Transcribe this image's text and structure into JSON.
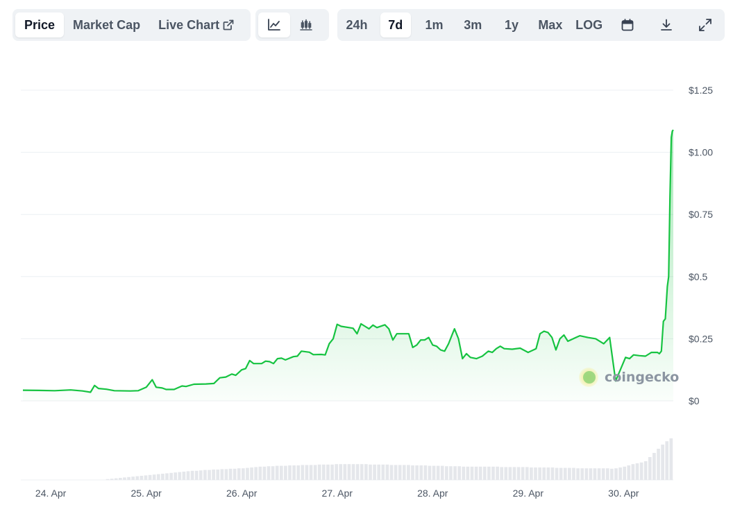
{
  "toolbar": {
    "view_tabs": [
      "Price",
      "Market Cap",
      "Live Chart"
    ],
    "active_view": "Price",
    "chart_type_buttons": [
      "line-chart-icon",
      "candlestick-icon"
    ],
    "active_chart_type": "line-chart-icon",
    "ranges": [
      "24h",
      "7d",
      "1m",
      "3m",
      "1y",
      "Max",
      "LOG"
    ],
    "active_range": "7d",
    "tool_icons": [
      "calendar-icon",
      "download-icon",
      "fullscreen-icon"
    ]
  },
  "watermark": {
    "text": "coingecko"
  },
  "colors": {
    "line": "#16c341",
    "fill": "#16c341",
    "grid": "#eceff3",
    "volume": "#e5e7eb",
    "accent_dot": "#f5e663"
  },
  "chart_data": {
    "type": "line",
    "y_tick_labels": [
      "$0",
      "$0.25",
      "$0.5",
      "$0.75",
      "$1.00",
      "$1.25"
    ],
    "y_ticks": [
      0,
      0.25,
      0.5,
      0.75,
      1.0,
      1.25
    ],
    "ylim": [
      0,
      1.25
    ],
    "x_tick_labels": [
      "24. Apr",
      "25. Apr",
      "26. Apr",
      "27. Apr",
      "28. Apr",
      "29. Apr",
      "30. Apr"
    ],
    "xlim": [
      "2024-04-23T17:00",
      "2024-04-30T12:30"
    ],
    "x_ticks": [
      "2024-04-24T00:00",
      "2024-04-25T00:00",
      "2024-04-26T00:00",
      "2024-04-27T00:00",
      "2024-04-28T00:00",
      "2024-04-29T00:00",
      "2024-04-30T00:00"
    ],
    "grid": true,
    "series": [
      {
        "points": [
          [
            "2024-04-23T17:00",
            0.043
          ],
          [
            "2024-04-23T21:00",
            0.042
          ],
          [
            "2024-04-24T01:00",
            0.041
          ],
          [
            "2024-04-24T05:00",
            0.044
          ],
          [
            "2024-04-24T08:00",
            0.04
          ],
          [
            "2024-04-24T10:00",
            0.035
          ],
          [
            "2024-04-24T11:00",
            0.062
          ],
          [
            "2024-04-24T12:00",
            0.05
          ],
          [
            "2024-04-24T14:00",
            0.047
          ],
          [
            "2024-04-24T16:00",
            0.041
          ],
          [
            "2024-04-24T20:00",
            0.04
          ],
          [
            "2024-04-24T22:00",
            0.041
          ],
          [
            "2024-04-25T00:00",
            0.055
          ],
          [
            "2024-04-25T01:30",
            0.085
          ],
          [
            "2024-04-25T02:30",
            0.055
          ],
          [
            "2024-04-25T04:00",
            0.052
          ],
          [
            "2024-04-25T05:00",
            0.046
          ],
          [
            "2024-04-25T07:00",
            0.046
          ],
          [
            "2024-04-25T09:00",
            0.06
          ],
          [
            "2024-04-25T10:00",
            0.058
          ],
          [
            "2024-04-25T12:00",
            0.067
          ],
          [
            "2024-04-25T15:00",
            0.068
          ],
          [
            "2024-04-25T17:00",
            0.07
          ],
          [
            "2024-04-25T18:30",
            0.093
          ],
          [
            "2024-04-25T20:00",
            0.096
          ],
          [
            "2024-04-25T21:30",
            0.108
          ],
          [
            "2024-04-25T22:30",
            0.103
          ],
          [
            "2024-04-26T00:00",
            0.125
          ],
          [
            "2024-04-26T01:00",
            0.13
          ],
          [
            "2024-04-26T02:00",
            0.162
          ],
          [
            "2024-04-26T03:00",
            0.15
          ],
          [
            "2024-04-26T05:00",
            0.15
          ],
          [
            "2024-04-26T06:00",
            0.16
          ],
          [
            "2024-04-26T07:00",
            0.158
          ],
          [
            "2024-04-26T08:00",
            0.15
          ],
          [
            "2024-04-26T09:00",
            0.17
          ],
          [
            "2024-04-26T10:00",
            0.172
          ],
          [
            "2024-04-26T11:00",
            0.165
          ],
          [
            "2024-04-26T13:00",
            0.178
          ],
          [
            "2024-04-26T14:00",
            0.18
          ],
          [
            "2024-04-26T15:00",
            0.2
          ],
          [
            "2024-04-26T17:00",
            0.196
          ],
          [
            "2024-04-26T18:00",
            0.186
          ],
          [
            "2024-04-26T20:00",
            0.187
          ],
          [
            "2024-04-26T21:00",
            0.185
          ],
          [
            "2024-04-26T22:00",
            0.23
          ],
          [
            "2024-04-26T23:00",
            0.25
          ],
          [
            "2024-04-27T00:00",
            0.308
          ],
          [
            "2024-04-27T01:00",
            0.3
          ],
          [
            "2024-04-27T03:00",
            0.295
          ],
          [
            "2024-04-27T04:00",
            0.292
          ],
          [
            "2024-04-27T05:00",
            0.27
          ],
          [
            "2024-04-27T06:00",
            0.31
          ],
          [
            "2024-04-27T07:00",
            0.3
          ],
          [
            "2024-04-27T08:00",
            0.29
          ],
          [
            "2024-04-27T09:00",
            0.305
          ],
          [
            "2024-04-27T10:00",
            0.295
          ],
          [
            "2024-04-27T12:00",
            0.306
          ],
          [
            "2024-04-27T13:00",
            0.29
          ],
          [
            "2024-04-27T14:00",
            0.245
          ],
          [
            "2024-04-27T15:00",
            0.27
          ],
          [
            "2024-04-27T17:00",
            0.27
          ],
          [
            "2024-04-27T18:00",
            0.27
          ],
          [
            "2024-04-27T19:00",
            0.215
          ],
          [
            "2024-04-27T20:00",
            0.225
          ],
          [
            "2024-04-27T21:00",
            0.245
          ],
          [
            "2024-04-27T22:00",
            0.245
          ],
          [
            "2024-04-27T23:00",
            0.255
          ],
          [
            "2024-04-28T00:00",
            0.225
          ],
          [
            "2024-04-28T01:00",
            0.22
          ],
          [
            "2024-04-28T02:00",
            0.205
          ],
          [
            "2024-04-28T03:00",
            0.2
          ],
          [
            "2024-04-28T04:00",
            0.23
          ],
          [
            "2024-04-28T05:00",
            0.27
          ],
          [
            "2024-04-28T05:30",
            0.29
          ],
          [
            "2024-04-28T06:30",
            0.25
          ],
          [
            "2024-04-28T07:30",
            0.17
          ],
          [
            "2024-04-28T08:30",
            0.19
          ],
          [
            "2024-04-28T09:30",
            0.175
          ],
          [
            "2024-04-28T11:00",
            0.17
          ],
          [
            "2024-04-28T12:30",
            0.18
          ],
          [
            "2024-04-28T14:00",
            0.2
          ],
          [
            "2024-04-28T15:00",
            0.195
          ],
          [
            "2024-04-28T16:00",
            0.21
          ],
          [
            "2024-04-28T17:00",
            0.22
          ],
          [
            "2024-04-28T18:00",
            0.21
          ],
          [
            "2024-04-28T20:00",
            0.208
          ],
          [
            "2024-04-28T22:00",
            0.212
          ],
          [
            "2024-04-29T00:00",
            0.195
          ],
          [
            "2024-04-29T02:00",
            0.21
          ],
          [
            "2024-04-29T03:00",
            0.27
          ],
          [
            "2024-04-29T04:00",
            0.28
          ],
          [
            "2024-04-29T05:00",
            0.275
          ],
          [
            "2024-04-29T06:00",
            0.255
          ],
          [
            "2024-04-29T07:00",
            0.205
          ],
          [
            "2024-04-29T08:00",
            0.25
          ],
          [
            "2024-04-29T09:00",
            0.265
          ],
          [
            "2024-04-29T10:00",
            0.24
          ],
          [
            "2024-04-29T12:00",
            0.255
          ],
          [
            "2024-04-29T13:00",
            0.262
          ],
          [
            "2024-04-29T15:00",
            0.255
          ],
          [
            "2024-04-29T17:00",
            0.25
          ],
          [
            "2024-04-29T19:00",
            0.23
          ],
          [
            "2024-04-29T20:30",
            0.255
          ],
          [
            "2024-04-29T22:00",
            0.08
          ],
          [
            "2024-04-30T00:30",
            0.175
          ],
          [
            "2024-04-30T01:30",
            0.17
          ],
          [
            "2024-04-30T02:30",
            0.185
          ],
          [
            "2024-04-30T04:00",
            0.182
          ],
          [
            "2024-04-30T05:30",
            0.18
          ],
          [
            "2024-04-30T07:00",
            0.195
          ],
          [
            "2024-04-30T08:30",
            0.195
          ],
          [
            "2024-04-30T09:00",
            0.19
          ],
          [
            "2024-04-30T09:30",
            0.2
          ],
          [
            "2024-04-30T10:00",
            0.32
          ],
          [
            "2024-04-30T10:30",
            0.33
          ],
          [
            "2024-04-30T11:00",
            0.46
          ],
          [
            "2024-04-30T11:20",
            0.5
          ],
          [
            "2024-04-30T11:40",
            0.82
          ],
          [
            "2024-04-30T12:00",
            1.06
          ],
          [
            "2024-04-30T12:15",
            1.085
          ],
          [
            "2024-04-30T12:30",
            1.09
          ]
        ]
      }
    ],
    "volume": {
      "values": [
        0,
        0,
        0,
        0,
        0,
        0,
        0,
        0,
        0,
        0,
        0,
        0,
        0,
        0,
        0,
        0,
        0,
        0,
        0,
        0,
        0.02,
        0.03,
        0.04,
        0.05,
        0.06,
        0.07,
        0.08,
        0.09,
        0.1,
        0.11,
        0.12,
        0.13,
        0.14,
        0.15,
        0.16,
        0.17,
        0.18,
        0.19,
        0.2,
        0.21,
        0.22,
        0.22,
        0.23,
        0.24,
        0.24,
        0.25,
        0.25,
        0.26,
        0.26,
        0.27,
        0.27,
        0.28,
        0.28,
        0.29,
        0.3,
        0.31,
        0.32,
        0.32,
        0.33,
        0.33,
        0.34,
        0.34,
        0.34,
        0.35,
        0.35,
        0.35,
        0.36,
        0.36,
        0.36,
        0.36,
        0.37,
        0.37,
        0.37,
        0.37,
        0.38,
        0.38,
        0.38,
        0.38,
        0.38,
        0.38,
        0.38,
        0.38,
        0.37,
        0.37,
        0.37,
        0.37,
        0.37,
        0.36,
        0.36,
        0.36,
        0.36,
        0.36,
        0.35,
        0.35,
        0.35,
        0.35,
        0.34,
        0.34,
        0.34,
        0.34,
        0.33,
        0.33,
        0.33,
        0.33,
        0.32,
        0.32,
        0.32,
        0.32,
        0.32,
        0.32,
        0.32,
        0.32,
        0.32,
        0.31,
        0.31,
        0.31,
        0.31,
        0.31,
        0.31,
        0.31,
        0.3,
        0.3,
        0.3,
        0.3,
        0.3,
        0.3,
        0.29,
        0.29,
        0.29,
        0.29,
        0.29,
        0.28,
        0.28,
        0.28,
        0.28,
        0.28,
        0.28,
        0.28,
        0.28,
        0.27,
        0.28,
        0.3,
        0.32,
        0.35,
        0.38,
        0.4,
        0.42,
        0.45,
        0.55,
        0.65,
        0.75,
        0.85,
        0.93,
        1.0
      ]
    }
  }
}
